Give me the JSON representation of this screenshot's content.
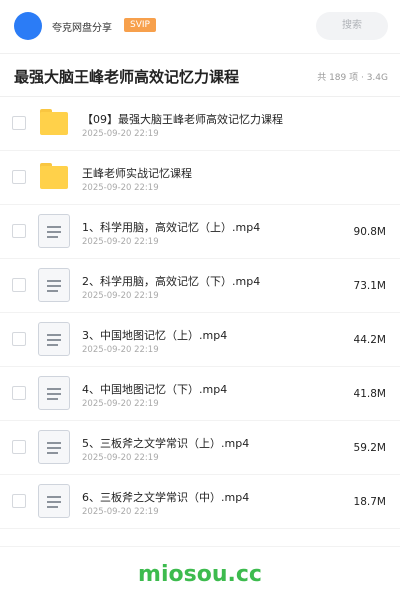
{
  "header": {
    "brand": "夸克网盘分享",
    "badge": "SVIP",
    "search_placeholder": "搜索"
  },
  "folder": {
    "title": "最强大脑王峰老师高效记忆力课程",
    "meta": "共 189 项 · 3.4G"
  },
  "items": [
    {
      "type": "folder",
      "name": "【09】最强大脑王峰老师高效记忆力课程",
      "date": "2025-09-20 22:19",
      "size": ""
    },
    {
      "type": "folder",
      "name": "王峰老师实战记忆课程",
      "date": "2025-09-20 22:19",
      "size": ""
    },
    {
      "type": "file",
      "name": "1、科学用脑，高效记忆（上）.mp4",
      "date": "2025-09-20 22:19",
      "size": "90.8M"
    },
    {
      "type": "file",
      "name": "2、科学用脑，高效记忆（下）.mp4",
      "date": "2025-09-20 22:19",
      "size": "73.1M"
    },
    {
      "type": "file",
      "name": "3、中国地图记忆（上）.mp4",
      "date": "2025-09-20 22:19",
      "size": "44.2M"
    },
    {
      "type": "file",
      "name": "4、中国地图记忆（下）.mp4",
      "date": "2025-09-20 22:19",
      "size": "41.8M"
    },
    {
      "type": "file",
      "name": "5、三板斧之文学常识（上）.mp4",
      "date": "2025-09-20 22:19",
      "size": "59.2M"
    },
    {
      "type": "file",
      "name": "6、三板斧之文学常识（中）.mp4",
      "date": "2025-09-20 22:19",
      "size": "18.7M"
    }
  ],
  "footer": {
    "watermark": "miosou.cc"
  },
  "colors": {
    "brand_blue": "#2b7cf6",
    "svip_orange": "#f7a04c",
    "folder_yellow": "#ffd14a",
    "watermark_green": "#3dbb4e"
  }
}
